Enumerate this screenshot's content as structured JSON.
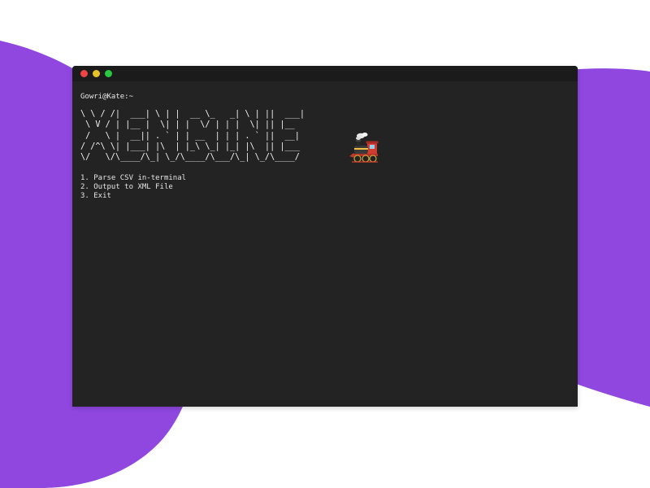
{
  "window": {
    "prompt": "Gowri@Kate:~"
  },
  "banner": {
    "ascii_art": "\\ \\ / /|  ___| \\ | |  __ \\_   _| \\ | ||  ___|\n \\ V / | |__ |  \\| | |  \\/ | | |  \\| || |__  \n /   \\ |  __|| . ` | | __  | | | . ` ||  __| \n/ /^\\ \\| |___| |\\  | |_\\ \\_| |_| |\\  || |___ \n\\/   \\/\\____/\\_| \\_/\\____/\\___/\\_| \\_/\\____/ ",
    "train_icon": "locomotive-icon"
  },
  "menu": {
    "items": [
      "1. Parse CSV in-terminal",
      "2. Output to XML File",
      "3. Exit"
    ]
  },
  "colors": {
    "accent_purple": "#8f47e0",
    "terminal_bg": "#232323",
    "titlebar_bg": "#1b1b1b",
    "close": "#ef4444",
    "minimize": "#e6c229",
    "maximize": "#27c93f"
  }
}
